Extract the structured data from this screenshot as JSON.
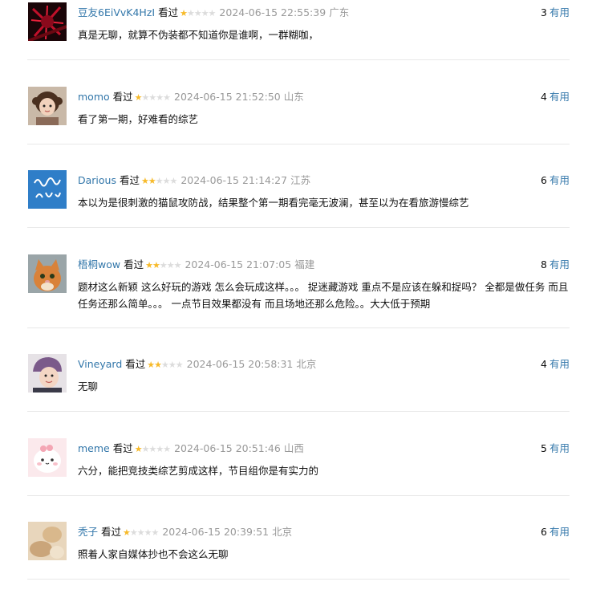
{
  "comments": [
    {
      "user": "豆友6EiVvK4HzI",
      "watched": "看过",
      "rating": 1,
      "time": "2024-06-15 22:55:39",
      "location": "广东",
      "votes": "3",
      "vote_label": "有用",
      "text": "真是无聊，就算不伪装都不知道你是谁啊，一群糊咖，",
      "avatar": "dark-red-abstract"
    },
    {
      "user": "momo",
      "watched": "看过",
      "rating": 1,
      "time": "2024-06-15 21:52:50",
      "location": "山东",
      "votes": "4",
      "vote_label": "有用",
      "text": "看了第一期，好难看的综艺",
      "avatar": "child-portrait"
    },
    {
      "user": "Darious",
      "watched": "看过",
      "rating": 2,
      "time": "2024-06-15 21:14:27",
      "location": "江苏",
      "votes": "6",
      "vote_label": "有用",
      "text": "本以为是很刺激的猫鼠攻防战，结果整个第一期看完毫无波澜，甚至以为在看旅游慢综艺",
      "avatar": "blue-hello-2019"
    },
    {
      "user": "梧桐wow",
      "watched": "看过",
      "rating": 2,
      "time": "2024-06-15 21:07:05",
      "location": "福建",
      "votes": "8",
      "vote_label": "有用",
      "text": "题材这么新颖 这么好玩的游戏 怎么会玩成这样。。。 捉迷藏游戏 重点不是应该在躲和捉吗？ 全都是做任务 而且任务还那么简单。。。 一点节目效果都没有 而且场地还那么危险。。大大低于预期",
      "avatar": "orange-cat"
    },
    {
      "user": "Vineyard",
      "watched": "看过",
      "rating": 2,
      "time": "2024-06-15 20:58:31",
      "location": "北京",
      "votes": "4",
      "vote_label": "有用",
      "text": "无聊",
      "avatar": "helmet-girl"
    },
    {
      "user": "meme",
      "watched": "看过",
      "rating": 1,
      "time": "2024-06-15 20:51:46",
      "location": "山西",
      "votes": "5",
      "vote_label": "有用",
      "text": "六分，能把竞技类综艺剪成这样，节目组你是有实力的",
      "avatar": "pink-cartoon"
    },
    {
      "user": "秃子",
      "watched": "看过",
      "rating": 1,
      "time": "2024-06-15 20:39:51",
      "location": "北京",
      "votes": "6",
      "vote_label": "有用",
      "text": "照着人家自媒体抄也不会这么无聊",
      "avatar": "beige-blur"
    }
  ],
  "colors": {
    "link": "#3377aa",
    "star": "#f7ba2a",
    "muted": "#999999"
  }
}
